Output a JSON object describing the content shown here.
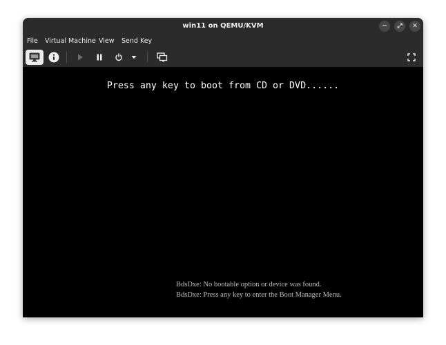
{
  "window": {
    "title": "win11 on QEMU/KVM",
    "controls": {
      "minimize": "−",
      "maximize": "⤢",
      "close": "✕"
    }
  },
  "menu": {
    "items": [
      "File",
      "Virtual Machine",
      "View",
      "Send Key"
    ]
  },
  "toolbar": {
    "icons": [
      "monitor-icon",
      "info-icon",
      "play-icon",
      "pause-icon",
      "power-icon",
      "dropdown-icon",
      "snapshots-icon",
      "fullscreen-icon"
    ]
  },
  "console": {
    "boot_prompt": "Press any key to boot from CD or DVD......",
    "bds_lines": [
      "BdsDxe: No bootable option or device was found.",
      "BdsDxe: Press any key to enter the Boot Manager Menu."
    ]
  },
  "colors": {
    "chrome": "#2b2b2b",
    "console_bg": "#000000",
    "prompt_text": "#ffffff",
    "bds_text": "#bdbdbd"
  }
}
